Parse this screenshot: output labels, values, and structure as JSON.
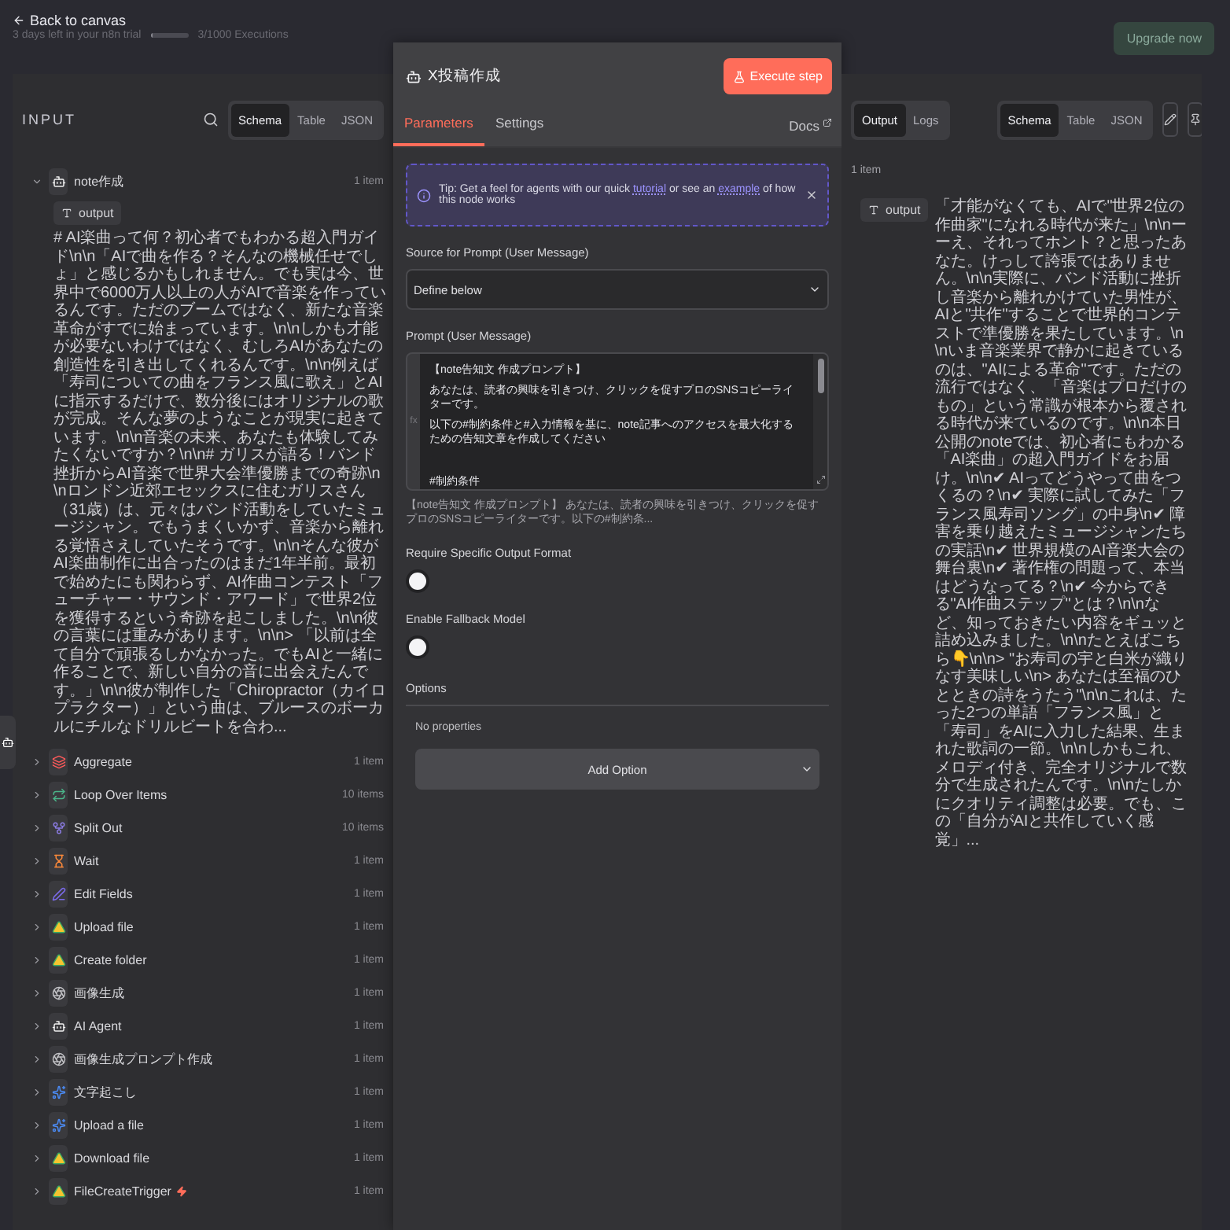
{
  "top_bar": {
    "back": "Back to canvas",
    "trial": "3 days left in your n8n trial",
    "executions": {
      "text": "3/1000 Executions",
      "level": 0.003
    },
    "upgrade": "Upgrade now"
  },
  "input_panel": {
    "title": "INPUT",
    "view_tabs": [
      {
        "label": "Schema",
        "selected": true
      },
      {
        "label": "Table",
        "selected": false
      },
      {
        "label": "JSON",
        "selected": false
      }
    ],
    "nodes": [
      {
        "kind": "agent",
        "name": "note作成",
        "count": "1 item",
        "expanded": true,
        "trigger": false,
        "output": {
          "label": "output",
          "value": "# AI楽曲って何？初心者でもわかる超入門ガイド\\n\\n「AIで曲を作る？そんなの機械任せでしょ」と感じるかもしれません。でも実は今、世界中で6000万人以上の人がAIで音楽を作っているんです。ただのブームではなく、新たな音楽革命がすでに始まっています。\\n\\nしかも才能が必要ないわけではなく、むしろAIがあなたの創造性を引き出してくれるんです。\\n\\n例えば「寿司についての曲をフランス風に歌え」とAIに指示するだけで、数分後にはオリジナルの歌が完成。そんな夢のようなことが現実に起きています。\\n\\n音楽の未来、あなたも体験してみたくないですか？\\n\\n# ガリスが語る！バンド挫折からAI音楽で世界大会準優勝までの奇跡\\n\\nロンドン近郊エセックスに住むガリスさん（31歳）は、元々はバンド活動をしていたミュージシャン。でもうまくいかず、音楽から離れる覚悟さえしていたそうです。\\n\\nそんな彼がAI楽曲制作に出合ったのはまだ1年半前。最初で始めたにも関わらず、AI作曲コンテスト「フューチャー・サウンド・アワード」で世界2位を獲得するという奇跡を起こしました。\\n\\n彼の言葉には重みがあります。\\n\\n> 「以前は全て自分で頑張るしかなかった。でもAIと一緒に作ることで、新しい自分の音に出会えたんです。」\\n\\n彼が制作した「Chiropractor（カイロプラクター）」という曲は、ブルースのボーカルにチルなドリルビートを合わ..."
        }
      },
      {
        "kind": "aggregate",
        "name": "Aggregate",
        "count": "1 item",
        "expanded": false,
        "trigger": false
      },
      {
        "kind": "loop",
        "name": "Loop Over Items",
        "count": "10 items",
        "expanded": false,
        "trigger": false
      },
      {
        "kind": "split",
        "name": "Split Out",
        "count": "10 items",
        "expanded": false,
        "trigger": false
      },
      {
        "kind": "wait",
        "name": "Wait",
        "count": "1 item",
        "expanded": false,
        "trigger": false
      },
      {
        "kind": "edit",
        "name": "Edit Fields",
        "count": "1 item",
        "expanded": false,
        "trigger": false
      },
      {
        "kind": "drive",
        "name": "Upload file",
        "count": "1 item",
        "expanded": false,
        "trigger": false
      },
      {
        "kind": "drive",
        "name": "Create folder",
        "count": "1 item",
        "expanded": false,
        "trigger": false
      },
      {
        "kind": "openai",
        "name": "画像生成",
        "count": "1 item",
        "expanded": false,
        "trigger": false
      },
      {
        "kind": "agent",
        "name": "AI Agent",
        "count": "1 item",
        "expanded": false,
        "trigger": false
      },
      {
        "kind": "openai",
        "name": "画像生成プロンプト作成",
        "count": "1 item",
        "expanded": false,
        "trigger": false
      },
      {
        "kind": "gemini",
        "name": "文字起こし",
        "count": "1 item",
        "expanded": false,
        "trigger": false
      },
      {
        "kind": "gemini",
        "name": "Upload a file",
        "count": "1 item",
        "expanded": false,
        "trigger": false
      },
      {
        "kind": "drive",
        "name": "Download file",
        "count": "1 item",
        "expanded": false,
        "trigger": false
      },
      {
        "kind": "drive",
        "name": "FileCreateTrigger",
        "count": "1 item",
        "expanded": false,
        "trigger": true
      }
    ]
  },
  "node_panel": {
    "title": "X投稿作成",
    "execute": "Execute step",
    "tabs": [
      {
        "label": "Parameters",
        "selected": true
      },
      {
        "label": "Settings",
        "selected": false
      }
    ],
    "docs": "Docs",
    "tip": {
      "before": "Tip: Get a feel for agents with our quick",
      "link1": "tutorial",
      "middle": "or see an",
      "link2": "example",
      "after": "of how this node works"
    },
    "source": {
      "label": "Source for Prompt (User Message)",
      "value": "Define below"
    },
    "prompt": {
      "label": "Prompt (User Message)",
      "expression_mark": "fx",
      "paragraphs": [
        [
          "【note告知文 作成プロンプト】",
          "あなたは、読者の興味を引きつけ、クリックを促すプロのSNSコピーライターです。",
          "以下の#制約条件と#入力情報を基に、note記事へのアクセスを最大化するための告知文章を作成してください"
        ],
        [
          "#制約条件"
        ]
      ],
      "preview": "【note告知文 作成プロンプト】 あなたは、読者の興味を引きつけ、クリックを促すプロのSNSコピーライターです。以下の#制約条..."
    },
    "toggles": [
      {
        "label": "Require Specific Output Format",
        "on": false
      },
      {
        "label": "Enable Fallback Model",
        "on": false
      }
    ],
    "options": {
      "title": "Options",
      "empty": "No properties",
      "button": "Add Option"
    }
  },
  "output_panel": {
    "tabs": [
      {
        "label": "Output",
        "selected": true
      },
      {
        "label": "Logs",
        "selected": false
      }
    ],
    "view_tabs": [
      {
        "label": "Schema",
        "selected": true
      },
      {
        "label": "Table",
        "selected": false
      },
      {
        "label": "JSON",
        "selected": false
      }
    ],
    "count": "1 item",
    "output": {
      "label": "output",
      "value": "「才能がなくても、AIで\"世界2位の作曲家\"になれる時代が来た」\\n\\nーーえ、それってホント？と思ったあなた。けっして誇張ではありません。\\n\\n実際に、バンド活動に挫折し音楽から離れかけていた男性が、AIと\"共作\"することで世界的コンテストで準優勝を果たしています。\\n\\nいま音楽業界で静かに起きているのは、\"AIによる革命\"です。ただの流行ではなく、「音楽はプロだけのもの」という常識が根本から覆される時代が来ているのです。\\n\\n本日公開のnoteでは、初心者にもわかる「AI楽曲」の超入門ガイドをお届け。\\n\\n✔ AIってどうやって曲をつくるの？\\n✔ 実際に試してみた「フランス風寿司ソング」の中身\\n✔ 障害を乗り越えたミュージシャンたちの実話\\n✔ 世界規模のAI音楽大会の舞台裏\\n✔ 著作権の問題って、本当はどうなってる？\\n✔ 今からできる\"AI作曲ステップ\"とは？\\n\\nなど、知っておきたい内容をギュッと詰め込みました。\\n\\nたとえばこちら👇\\n\\n> \"お寿司の宇と白米が織りなす美味しい\\n> あなたは至福のひとときの詩をうたう\"\\n\\nこれは、たった2つの単語「フランス風」と「寿司」をAIに入力した結果、生まれた歌詞の一節。\\n\\nしかもこれ、メロディ付き、完全オリジナルで数分で生成されたんです。\\n\\nたしかにクオリティ調整は必要。でも、この「自分がAIと共作していく感覚」..."
    }
  }
}
